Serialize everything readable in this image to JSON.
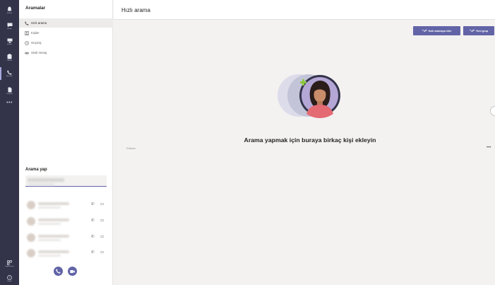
{
  "rail": {
    "items": [
      {
        "label": "Etkinlik",
        "icon": "bell-icon"
      },
      {
        "label": "Sohbet",
        "icon": "chat-icon"
      },
      {
        "label": "Ekipler",
        "icon": "teams-icon"
      },
      {
        "label": "Ödevler",
        "icon": "assignments-icon"
      },
      {
        "label": "Aramalar",
        "icon": "phone-icon"
      },
      {
        "label": "Dosyalar",
        "icon": "file-icon"
      }
    ],
    "more": "•••",
    "bottom": [
      {
        "label": "Uygulamalar",
        "icon": "apps-icon"
      },
      {
        "label": "Yardım",
        "icon": "help-icon"
      }
    ]
  },
  "panel": {
    "title": "Aramalar",
    "nav": [
      {
        "label": "Hızlı arama",
        "icon": "phone-icon"
      },
      {
        "label": "Kişiler",
        "icon": "contacts-icon"
      },
      {
        "label": "Geçmiş",
        "icon": "history-icon"
      },
      {
        "label": "Sesli mesaj",
        "icon": "voicemail-icon"
      }
    ],
    "call_title": "Arama yap"
  },
  "main": {
    "title": "Hızlı arama",
    "add_speed_dial": "Hızlı aramaya ekle",
    "new_group": "Yeni grup",
    "empty_message": "Arama yapmak için buraya birkaç kişi ekleyin",
    "small_label": "Grubum",
    "more": "•••"
  },
  "colors": {
    "accent": "#6264a7",
    "rail": "#33344a",
    "plus_green": "#8dc63f"
  }
}
